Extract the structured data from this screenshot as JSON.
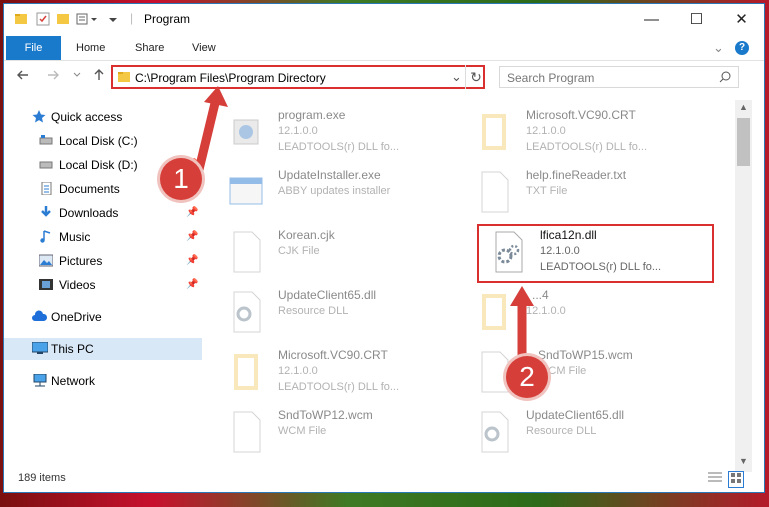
{
  "window": {
    "title": "Program",
    "minimize": "—",
    "maximize": "☐",
    "close": "✕"
  },
  "ribbon": {
    "tabs": [
      "File",
      "Home",
      "Share",
      "View"
    ],
    "expand": "⌄",
    "help": "?"
  },
  "address": {
    "path": "C:\\Program Files\\Program Directory",
    "dropdown": "⌄",
    "refresh": "↻",
    "search_placeholder": "Search Program"
  },
  "nav": {
    "items": [
      {
        "label": "Quick access",
        "icon": "star-icon"
      },
      {
        "label": "Local Disk (C:)",
        "icon": "drive-icon"
      },
      {
        "label": "Local Disk (D:)",
        "icon": "drive-icon"
      },
      {
        "label": "Documents",
        "icon": "documents-icon"
      },
      {
        "label": "Downloads",
        "icon": "download-icon"
      },
      {
        "label": "Music",
        "icon": "music-icon"
      },
      {
        "label": "Pictures",
        "icon": "pictures-icon"
      },
      {
        "label": "Videos",
        "icon": "videos-icon"
      },
      {
        "label": "OneDrive",
        "icon": "cloud-icon"
      },
      {
        "label": "This PC",
        "icon": "computer-icon"
      },
      {
        "label": "Network",
        "icon": "network-icon"
      }
    ]
  },
  "files": [
    {
      "name": "program.exe",
      "line2": "12.1.0.0",
      "line3": "LEADTOOLS(r) DLL fo...",
      "icon": "exe"
    },
    {
      "name": "Microsoft.VC90.CRT",
      "line2": "12.1.0.0",
      "line3": "LEADTOOLS(r) DLL fo...",
      "icon": "folder"
    },
    {
      "name": "UpdateInstaller.exe",
      "line2": "ABBY updates installer",
      "line3": "",
      "icon": "installer"
    },
    {
      "name": "help.fineReader.txt",
      "line2": "TXT File",
      "line3": "",
      "icon": "doc"
    },
    {
      "name": "Korean.cjk",
      "line2": "CJK File",
      "line3": "",
      "icon": "doc"
    },
    {
      "name": "lfica12n.dll",
      "line2": "12.1.0.0",
      "line3": "LEADTOOLS(r) DLL fo...",
      "icon": "dll"
    },
    {
      "name": "UpdateClient65.dll",
      "line2": "Resource DLL",
      "line3": "",
      "icon": "dll"
    },
    {
      "name": "...4",
      "line2": "12.1.0.0",
      "line3": "",
      "icon": "folder"
    },
    {
      "name": "Microsoft.VC90.CRT",
      "line2": "12.1.0.0",
      "line3": "LEADTOOLS(r) DLL fo...",
      "icon": "folder"
    },
    {
      "name": "SndToWP15.wcm",
      "line2": "WCM File",
      "line3": "",
      "icon": "doc"
    },
    {
      "name": "SndToWP12.wcm",
      "line2": "WCM File",
      "line3": "",
      "icon": "doc"
    },
    {
      "name": "UpdateClient65.dll",
      "line2": "Resource DLL",
      "line3": "",
      "icon": "dll"
    }
  ],
  "status": {
    "count": "189 items"
  },
  "callouts": [
    "1",
    "2"
  ]
}
